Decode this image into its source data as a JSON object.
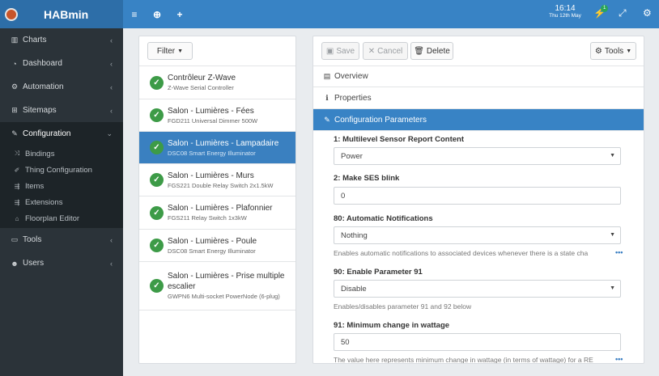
{
  "app": {
    "title": "HABmin"
  },
  "sidebar": {
    "items": [
      {
        "label": "Charts",
        "icon": "bar-chart-icon"
      },
      {
        "label": "Dashboard",
        "icon": "dashboard-icon"
      },
      {
        "label": "Automation",
        "icon": "gears-icon"
      },
      {
        "label": "Sitemaps",
        "icon": "sitemap-icon"
      },
      {
        "label": "Configuration",
        "icon": "wrench-icon"
      },
      {
        "label": "Tools",
        "icon": "laptop-icon"
      },
      {
        "label": "Users",
        "icon": "users-icon"
      }
    ],
    "sub_items": [
      {
        "label": "Bindings",
        "icon": "random-icon"
      },
      {
        "label": "Thing Configuration",
        "icon": "magic-icon"
      },
      {
        "label": "Items",
        "icon": "signs-icon"
      },
      {
        "label": "Extensions",
        "icon": "signs-icon"
      },
      {
        "label": "Floorplan Editor",
        "icon": "home-icon"
      }
    ]
  },
  "topbar": {
    "time": "16:14",
    "date": "Thu 12th May",
    "notification_count": "1"
  },
  "filter": {
    "label": "Filter"
  },
  "things": [
    {
      "name": "Contrôleur Z-Wave",
      "desc": "Z-Wave Serial Controller"
    },
    {
      "name": "Salon - Lumières - Fées",
      "desc": "FGD211 Universal Dimmer 500W"
    },
    {
      "name": "Salon - Lumières - Lampadaire",
      "desc": "DSC08 Smart Energy Illuminator"
    },
    {
      "name": "Salon - Lumières - Murs",
      "desc": "FGS221 Double Relay Switch 2x1.5kW"
    },
    {
      "name": "Salon - Lumières - Plafonnier",
      "desc": "FGS211 Relay Switch 1x3kW"
    },
    {
      "name": "Salon - Lumières - Poule",
      "desc": "DSC08 Smart Energy Illuminator"
    },
    {
      "name": "Salon - Lumières - Prise multiple escalier",
      "desc": "GWPN6 Multi-socket PowerNode (6-plug)"
    }
  ],
  "toolbar": {
    "save": "Save",
    "cancel": "Cancel",
    "delete": "Delete",
    "tools": "Tools"
  },
  "sections": {
    "overview": "Overview",
    "properties": "Properties",
    "config": "Configuration Parameters"
  },
  "params": {
    "p1": {
      "label": "1: Multilevel Sensor Report Content",
      "value": "Power"
    },
    "p2": {
      "label": "2: Make SES blink",
      "value": "0"
    },
    "p80": {
      "label": "80: Automatic Notifications",
      "value": "Nothing",
      "help": "Enables automatic notifications to associated devices whenever there is a state cha"
    },
    "p90": {
      "label": "90: Enable Parameter 91",
      "value": "Disable",
      "help": "Enables/disables parameter 91 and 92 below"
    },
    "p91": {
      "label": "91: Minimum change in wattage",
      "value": "50",
      "help": "The value here represents minimum change in wattage (in terms of wattage) for a RE"
    }
  }
}
